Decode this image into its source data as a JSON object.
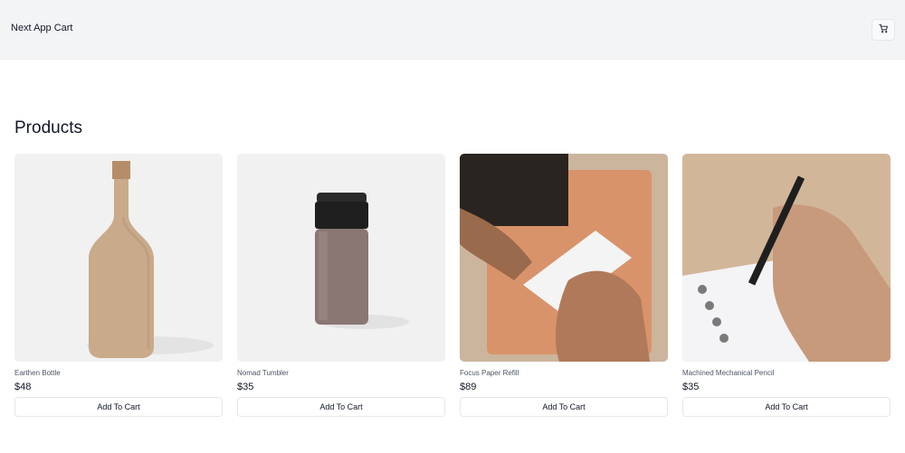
{
  "header": {
    "brand": "Next App Cart"
  },
  "main": {
    "title": "Products",
    "products": [
      {
        "name": "Earthen Bottle",
        "price": "$48",
        "button": "Add To Cart"
      },
      {
        "name": "Nomad Tumbler",
        "price": "$35",
        "button": "Add To Cart"
      },
      {
        "name": "Focus Paper Refill",
        "price": "$89",
        "button": "Add To Cart"
      },
      {
        "name": "Machined Mechanical Pencil",
        "price": "$35",
        "button": "Add To Cart"
      }
    ]
  },
  "icons": {
    "cart": "shopping-cart-icon"
  }
}
